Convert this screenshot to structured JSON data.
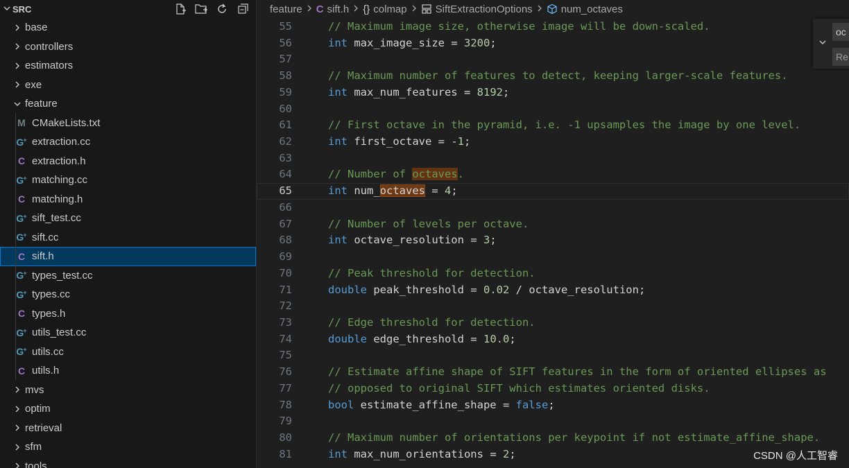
{
  "explorer": {
    "root_label": "SRC",
    "items": [
      {
        "label": "base",
        "kind": "folder",
        "expanded": false
      },
      {
        "label": "controllers",
        "kind": "folder",
        "expanded": false
      },
      {
        "label": "estimators",
        "kind": "folder",
        "expanded": false
      },
      {
        "label": "exe",
        "kind": "folder",
        "expanded": false
      },
      {
        "label": "feature",
        "kind": "folder",
        "expanded": true
      },
      {
        "label": "CMakeLists.txt",
        "kind": "file",
        "icon": "cmake-icon"
      },
      {
        "label": "extraction.cc",
        "kind": "file",
        "icon": "cpp-file-icon"
      },
      {
        "label": "extraction.h",
        "kind": "file",
        "icon": "c-header-icon"
      },
      {
        "label": "matching.cc",
        "kind": "file",
        "icon": "cpp-file-icon"
      },
      {
        "label": "matching.h",
        "kind": "file",
        "icon": "c-header-icon"
      },
      {
        "label": "sift_test.cc",
        "kind": "file",
        "icon": "cpp-file-icon"
      },
      {
        "label": "sift.cc",
        "kind": "file",
        "icon": "cpp-file-icon"
      },
      {
        "label": "sift.h",
        "kind": "file",
        "icon": "c-header-icon",
        "selected": true
      },
      {
        "label": "types_test.cc",
        "kind": "file",
        "icon": "cpp-file-icon"
      },
      {
        "label": "types.cc",
        "kind": "file",
        "icon": "cpp-file-icon"
      },
      {
        "label": "types.h",
        "kind": "file",
        "icon": "c-header-icon"
      },
      {
        "label": "utils_test.cc",
        "kind": "file",
        "icon": "cpp-file-icon"
      },
      {
        "label": "utils.cc",
        "kind": "file",
        "icon": "cpp-file-icon"
      },
      {
        "label": "utils.h",
        "kind": "file",
        "icon": "c-header-icon"
      },
      {
        "label": "mvs",
        "kind": "folder",
        "expanded": false
      },
      {
        "label": "optim",
        "kind": "folder",
        "expanded": false
      },
      {
        "label": "retrieval",
        "kind": "folder",
        "expanded": false
      },
      {
        "label": "sfm",
        "kind": "folder",
        "expanded": false
      },
      {
        "label": "tools",
        "kind": "folder",
        "expanded": false
      }
    ]
  },
  "breadcrumb": {
    "folder": "feature",
    "file": "sift.h",
    "namespace": "colmap",
    "struct": "SiftExtractionOptions",
    "member": "num_octaves"
  },
  "find_widget": {
    "find_value": "oc",
    "replace_placeholder": "Re"
  },
  "editor": {
    "current_line": 65,
    "lines": [
      {
        "n": 55,
        "tokens": [
          [
            "c-comment",
            "// Maximum image size, otherwise image will be down-scaled."
          ]
        ]
      },
      {
        "n": 56,
        "tokens": [
          [
            "c-kw",
            "int"
          ],
          [
            "c-id",
            " max_image_size "
          ],
          [
            "c-op",
            "= "
          ],
          [
            "c-num",
            "3200"
          ],
          [
            "c-op",
            ";"
          ]
        ]
      },
      {
        "n": 57,
        "tokens": []
      },
      {
        "n": 58,
        "tokens": [
          [
            "c-comment",
            "// Maximum number of features to detect, keeping larger-scale features."
          ]
        ]
      },
      {
        "n": 59,
        "tokens": [
          [
            "c-kw",
            "int"
          ],
          [
            "c-id",
            " max_num_features "
          ],
          [
            "c-op",
            "= "
          ],
          [
            "c-num",
            "8192"
          ],
          [
            "c-op",
            ";"
          ]
        ]
      },
      {
        "n": 60,
        "tokens": []
      },
      {
        "n": 61,
        "tokens": [
          [
            "c-comment",
            "// First octave in the pyramid, i.e. -1 upsamples the image by one level."
          ]
        ]
      },
      {
        "n": 62,
        "tokens": [
          [
            "c-kw",
            "int"
          ],
          [
            "c-id",
            " first_octave "
          ],
          [
            "c-op",
            "= -"
          ],
          [
            "c-num",
            "1"
          ],
          [
            "c-op",
            ";"
          ]
        ]
      },
      {
        "n": 63,
        "tokens": []
      },
      {
        "n": 64,
        "tokens": [
          [
            "c-comment",
            "// Number of "
          ],
          [
            "c-comment hl",
            "octaves"
          ],
          [
            "c-comment",
            "."
          ]
        ]
      },
      {
        "n": 65,
        "tokens": [
          [
            "c-kw",
            "int"
          ],
          [
            "c-id",
            " num_"
          ],
          [
            "c-id hl-strong",
            "octaves"
          ],
          [
            "c-id",
            " "
          ],
          [
            "c-op",
            "= "
          ],
          [
            "c-num",
            "4"
          ],
          [
            "c-op",
            ";"
          ]
        ]
      },
      {
        "n": 66,
        "tokens": []
      },
      {
        "n": 67,
        "tokens": [
          [
            "c-comment",
            "// Number of levels per octave."
          ]
        ]
      },
      {
        "n": 68,
        "tokens": [
          [
            "c-kw",
            "int"
          ],
          [
            "c-id",
            " octave_resolution "
          ],
          [
            "c-op",
            "= "
          ],
          [
            "c-num",
            "3"
          ],
          [
            "c-op",
            ";"
          ]
        ]
      },
      {
        "n": 69,
        "tokens": []
      },
      {
        "n": 70,
        "tokens": [
          [
            "c-comment",
            "// Peak threshold for detection."
          ]
        ]
      },
      {
        "n": 71,
        "tokens": [
          [
            "c-kw",
            "double"
          ],
          [
            "c-id",
            " peak_threshold "
          ],
          [
            "c-op",
            "= "
          ],
          [
            "c-num",
            "0.02"
          ],
          [
            "c-op",
            " / "
          ],
          [
            "c-id",
            "octave_resolution"
          ],
          [
            "c-op",
            ";"
          ]
        ]
      },
      {
        "n": 72,
        "tokens": []
      },
      {
        "n": 73,
        "tokens": [
          [
            "c-comment",
            "// Edge threshold for detection."
          ]
        ]
      },
      {
        "n": 74,
        "tokens": [
          [
            "c-kw",
            "double"
          ],
          [
            "c-id",
            " edge_threshold "
          ],
          [
            "c-op",
            "= "
          ],
          [
            "c-num",
            "10.0"
          ],
          [
            "c-op",
            ";"
          ]
        ]
      },
      {
        "n": 75,
        "tokens": []
      },
      {
        "n": 76,
        "tokens": [
          [
            "c-comment",
            "// Estimate affine shape of SIFT features in the form of oriented ellipses as"
          ]
        ]
      },
      {
        "n": 77,
        "tokens": [
          [
            "c-comment",
            "// opposed to original SIFT which estimates oriented disks."
          ]
        ]
      },
      {
        "n": 78,
        "tokens": [
          [
            "c-kw",
            "bool"
          ],
          [
            "c-id",
            " estimate_affine_shape "
          ],
          [
            "c-op",
            "= "
          ],
          [
            "c-kw",
            "false"
          ],
          [
            "c-op",
            ";"
          ]
        ]
      },
      {
        "n": 79,
        "tokens": []
      },
      {
        "n": 80,
        "tokens": [
          [
            "c-comment",
            "// Maximum number of orientations per keypoint if not estimate_affine_shape."
          ]
        ]
      },
      {
        "n": 81,
        "tokens": [
          [
            "c-kw",
            "int"
          ],
          [
            "c-id",
            " max_num_orientations "
          ],
          [
            "c-op",
            "= "
          ],
          [
            "c-num",
            "2"
          ],
          [
            "c-op",
            ";"
          ]
        ]
      }
    ]
  },
  "watermark": "CSDN @人工智睿",
  "colors": {
    "selection": "#04395e",
    "selection_border": "#0078d4",
    "comment": "#6a9955",
    "keyword": "#569cd6",
    "number": "#b5cea8",
    "cpp_icon": "#519aba",
    "c_header_icon": "#a074c4",
    "cmake_icon": "#6d8086"
  }
}
